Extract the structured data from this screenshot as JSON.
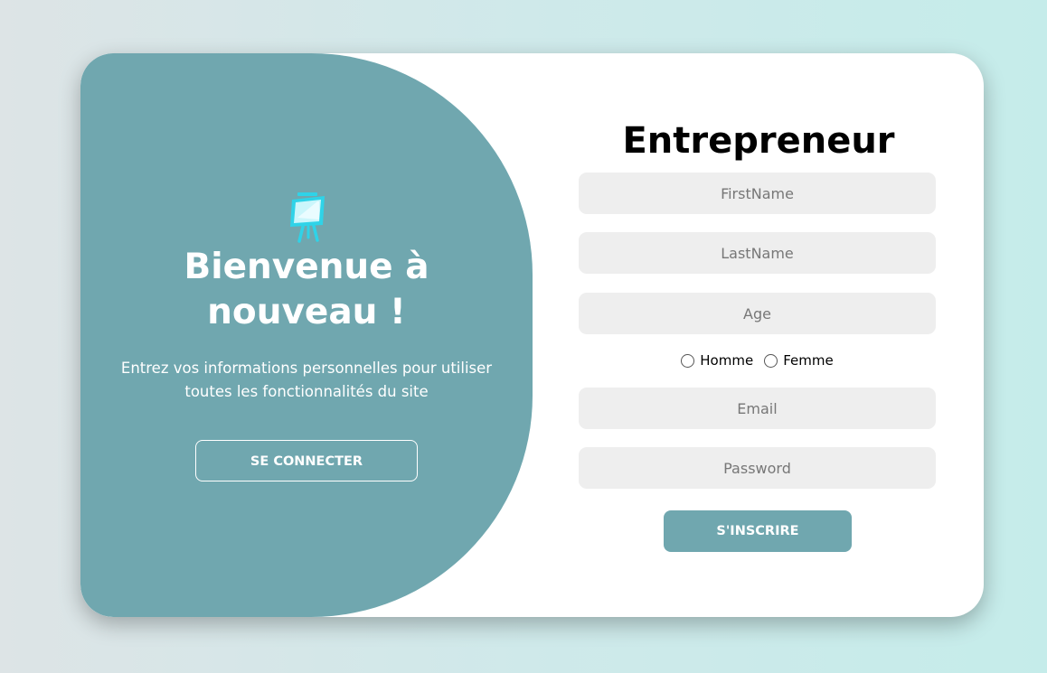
{
  "left_panel": {
    "logo_icon": "easel-board-icon",
    "title": "Bienvenue à nouveau !",
    "text": "Entrez vos informations personnelles pour utiliser toutes les fonctionnalités du site",
    "connect_label": "SE CONNECTER"
  },
  "form": {
    "title": "Entrepreneur",
    "firstname_placeholder": "FirstName",
    "lastname_placeholder": "LastName",
    "age_placeholder": "Age",
    "gender_options": [
      "Homme",
      "Femme"
    ],
    "email_placeholder": "Email",
    "password_placeholder": "Password",
    "submit_label": "S'INSCRIRE"
  },
  "colors": {
    "accent": "#70a7af",
    "field_bg": "#eeeeee",
    "card_bg": "#ffffff"
  }
}
